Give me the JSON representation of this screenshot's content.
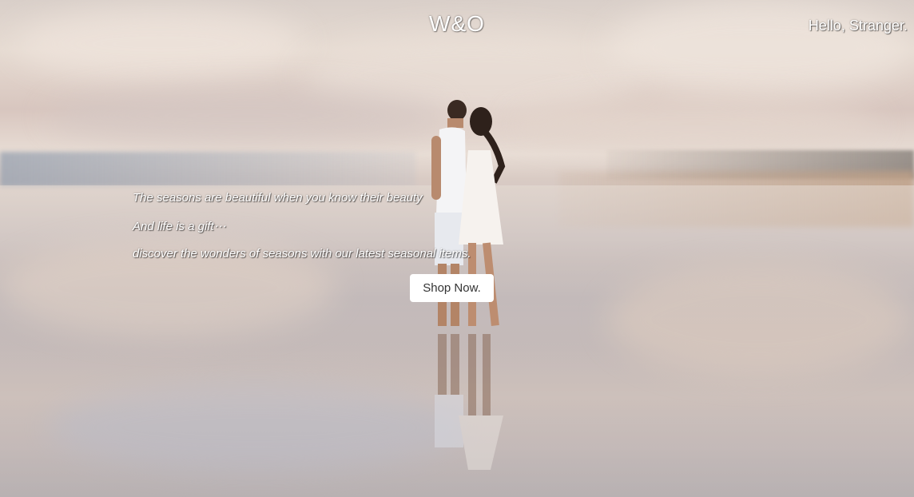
{
  "header": {
    "brand": "W&O",
    "greeting": "Hello, Stranger."
  },
  "hero": {
    "lines": [
      "The seasons are beautiful when you know their beauty",
      "And life is a gift⋯",
      "discover the wonders of seasons with our latest seasonal items."
    ],
    "cta_label": "Shop Now."
  },
  "background": {
    "scene": "couple-on-reflective-beach-photo",
    "accent": "#ffffff"
  }
}
